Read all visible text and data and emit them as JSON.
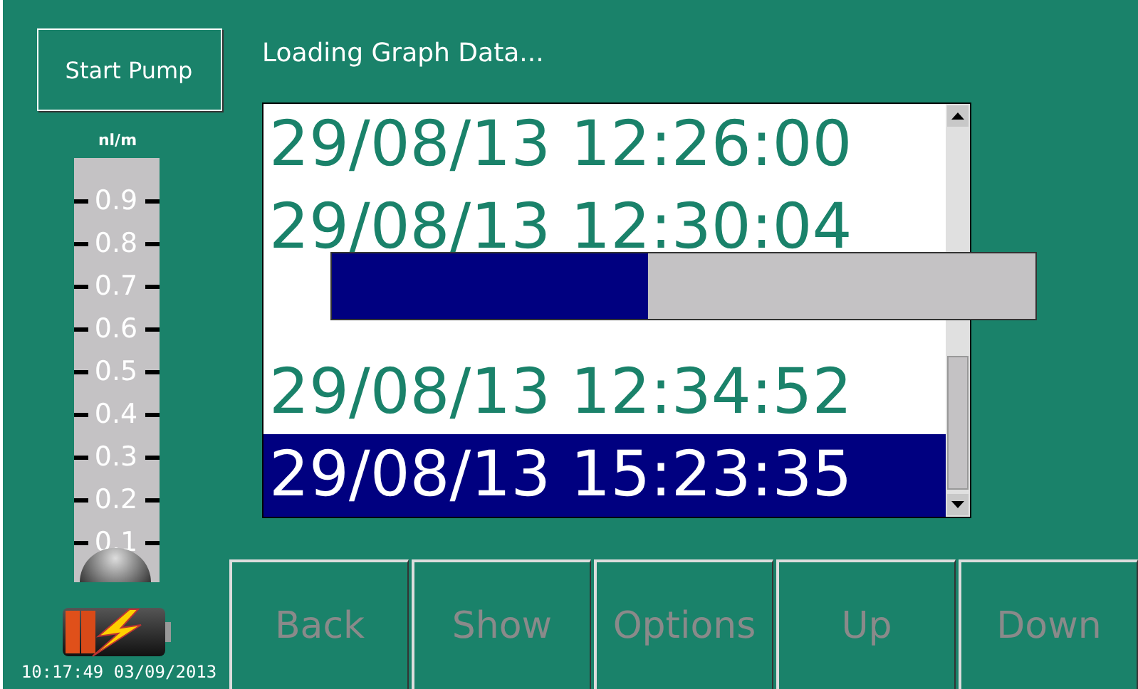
{
  "start_button": {
    "label": "Start Pump",
    "disabled": false
  },
  "gauge": {
    "unit": "nl/m",
    "level": 0,
    "ticks": [
      "0.9",
      "0.8",
      "0.7",
      "0.6",
      "0.5",
      "0.4",
      "0.3",
      "0.2",
      "0.1"
    ]
  },
  "status": {
    "time": "10:17:49 03/09/2013"
  },
  "title": "Loading Graph Data...",
  "list": {
    "rows": [
      {
        "text": "29/08/13 12:26:00",
        "selected": false
      },
      {
        "text": "29/08/13 12:30:04",
        "selected": false
      },
      {
        "selected": false
      },
      {
        "text": "29/08/13 12:34:52",
        "selected": false
      },
      {
        "text": "29/08/13 15:23:35",
        "selected": true
      }
    ]
  },
  "progress": {
    "level": 0.45
  },
  "buttons": [
    {
      "label": "Back",
      "disabled": true
    },
    {
      "label": "Show",
      "disabled": true
    },
    {
      "label": "Options",
      "disabled": true
    },
    {
      "label": "Up",
      "disabled": true
    },
    {
      "label": "Down",
      "disabled": true
    }
  ]
}
